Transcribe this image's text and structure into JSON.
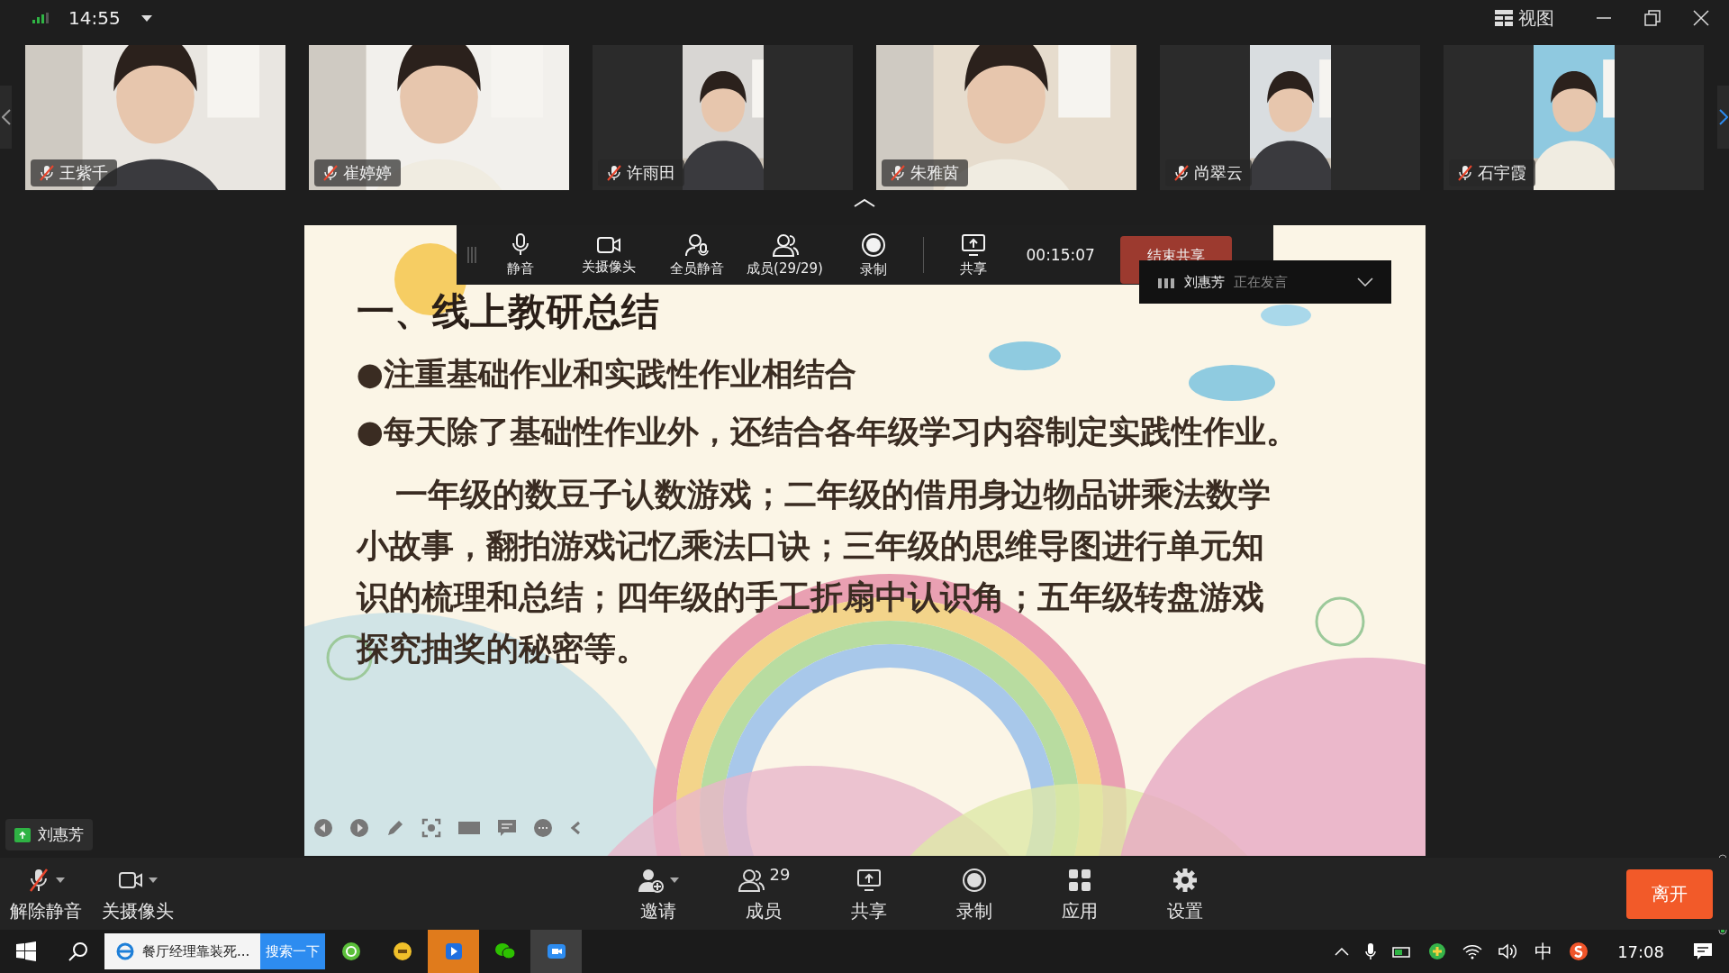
{
  "top_bar": {
    "time": "14:55",
    "view_label": "视图"
  },
  "participants": [
    {
      "name": "王紫千",
      "muted": true,
      "kind": "wide"
    },
    {
      "name": "崔婷婷",
      "muted": true,
      "kind": "wide"
    },
    {
      "name": "许雨田",
      "muted": true,
      "kind": "narrow"
    },
    {
      "name": "朱雅茵",
      "muted": true,
      "kind": "wide"
    },
    {
      "name": "尚翠云",
      "muted": true,
      "kind": "narrow"
    },
    {
      "name": "石宇霞",
      "muted": true,
      "kind": "narrow"
    }
  ],
  "meeting_toolbar": {
    "buttons": [
      {
        "label": "静音",
        "kind": "mic"
      },
      {
        "label": "关摄像头",
        "kind": "camera"
      },
      {
        "label": "全员静音",
        "kind": "mute-all"
      },
      {
        "label": "成员(29/29)",
        "kind": "members"
      },
      {
        "label": "录制",
        "kind": "record"
      },
      {
        "label": "共享",
        "kind": "share"
      }
    ],
    "timer": "00:15:07",
    "end_share": "结束共享"
  },
  "speaker": {
    "name": "刘惠芳",
    "status": "正在发言"
  },
  "slide": {
    "title": "一、线上教研总结",
    "bullets": [
      "●注重基础作业和实践性作业相结合",
      "●每天除了基础性作业外，还结合各年级学习内容制定实践性作业。"
    ],
    "paragraph": "一年级的数豆子认数游戏；二年级的借用身边物品讲乘法数学小故事，翻拍游戏记忆乘法口诀；三年级的思维导图进行单元知识的梳理和总结；四年级的手工折扇中认识角；五年级转盘游戏探究抽奖的秘密等。"
  },
  "sharer": "刘惠芳",
  "bottom_bar": {
    "left": [
      {
        "label": "解除静音",
        "kind": "mic-off"
      },
      {
        "label": "关摄像头",
        "kind": "camera"
      }
    ],
    "center": [
      {
        "label": "邀请",
        "kind": "invite"
      },
      {
        "label": "成员",
        "kind": "members",
        "count": "29"
      },
      {
        "label": "共享",
        "kind": "share"
      },
      {
        "label": "录制",
        "kind": "record"
      },
      {
        "label": "应用",
        "kind": "apps"
      },
      {
        "label": "设置",
        "kind": "settings"
      }
    ],
    "leave": "离开"
  },
  "taskbar": {
    "browser_tab": "餐厅经理靠装死...",
    "search_button": "搜索一下",
    "ime": "中",
    "clock": "17:08"
  }
}
